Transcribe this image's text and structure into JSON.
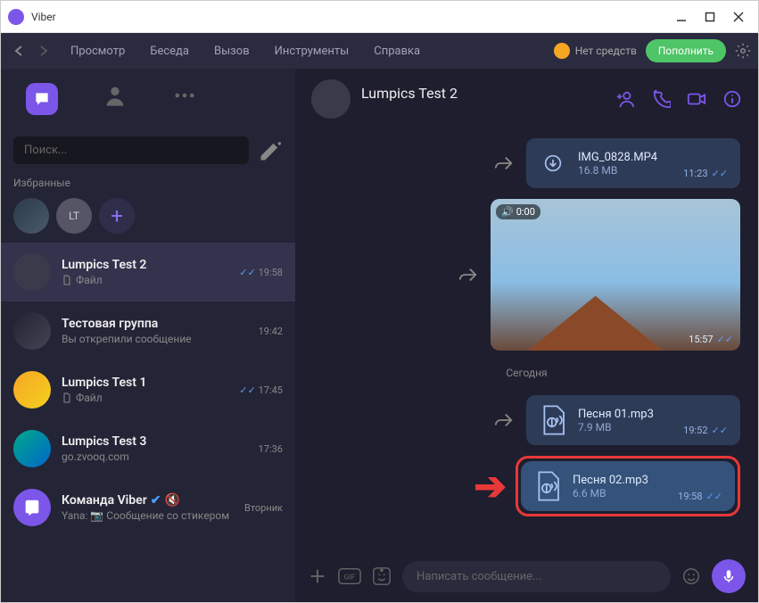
{
  "titlebar": {
    "app_name": "Viber"
  },
  "menubar": {
    "items": [
      "Просмотр",
      "Беседа",
      "Вызов",
      "Инструменты",
      "Справка"
    ],
    "balance_label": "Нет средств",
    "topup_label": "Пополнить"
  },
  "sidebar": {
    "search_placeholder": "Поиск...",
    "favorites_label": "Избранные",
    "fav_badge": "LT",
    "chats": [
      {
        "name": "Lumpics Test 2",
        "subtitle": "Файл",
        "time": "19:58",
        "checks": true,
        "pinned": "Вы открепили сообщение"
      },
      {
        "name": "Тестовая группа",
        "subtitle": "",
        "time": "19:42"
      },
      {
        "name": "Lumpics Test 1",
        "subtitle": "Файл",
        "time": "17:45",
        "checks": true
      },
      {
        "name": "Lumpics Test 3",
        "subtitle": "go.zvooq.com",
        "time": "17:36"
      },
      {
        "name": "Команда Viber",
        "subtitle": "Yana: 📷 Сообщение со стикером",
        "time": "Вторник",
        "verified": true,
        "muted": true
      }
    ]
  },
  "chat": {
    "header": {
      "name": "Lumpics Test 2"
    },
    "file1": {
      "name": "IMG_0828.MP4",
      "size": "16.8 MB",
      "time": "11:23"
    },
    "video": {
      "duration": "0:00",
      "time": "15:57"
    },
    "separator": "Сегодня",
    "file2": {
      "name": "Песня 01.mp3",
      "size": "7.9 MB",
      "time": "19:52"
    },
    "file3": {
      "name": "Песня 02.mp3",
      "size": "6.6 MB",
      "time": "19:58"
    }
  },
  "composer": {
    "placeholder": "Написать сообщение..."
  }
}
